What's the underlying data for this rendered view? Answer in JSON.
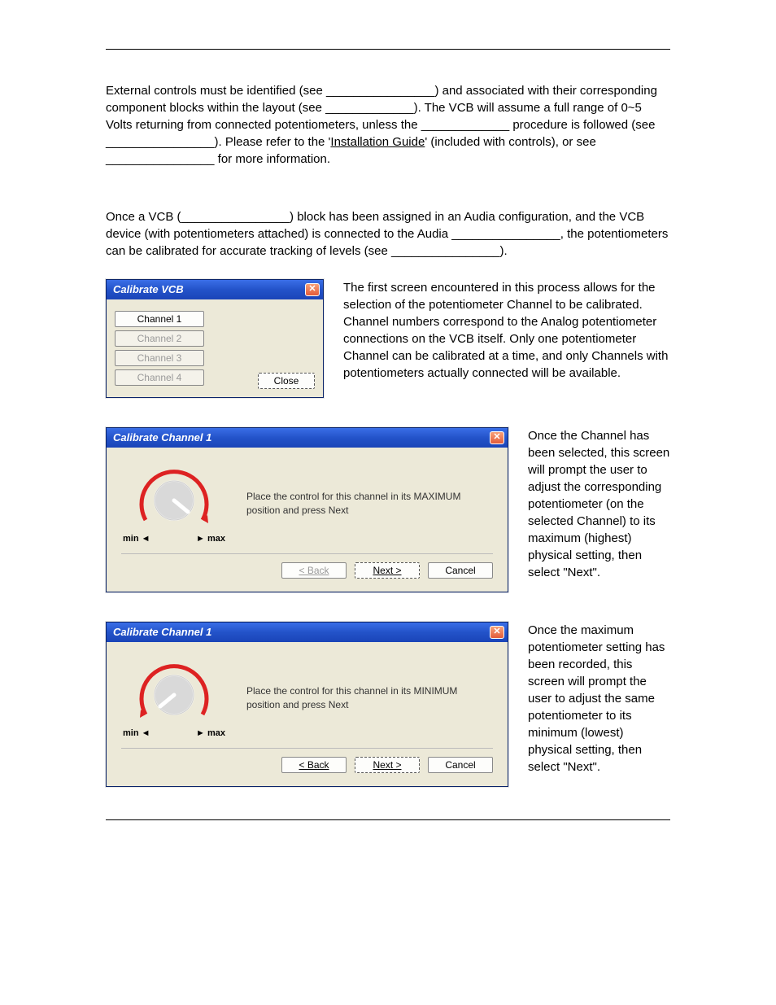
{
  "intro": {
    "p1_a": "External controls must be identified (see ",
    "p1_b": ") and associated with their corresponding component blocks within the layout (see ",
    "p1_c": "). The VCB will assume a full range of 0~5 Volts returning from connected potentiometers, unless the ",
    "p1_d": " procedure is followed (see ",
    "p1_e": "). Please refer to the '",
    "install_guide": "Installation Guide",
    "p1_f": "' (included with controls), or see ",
    "p1_g": " for more information."
  },
  "calibrate_intro": {
    "a": "Once a VCB (",
    "b": ") block has been assigned in an Audia configuration, and the VCB device (with potentiometers attached) is connected to the Audia ",
    "c": ", the potentiometers can be calibrated for accurate tracking of levels (see ",
    "d": ")."
  },
  "dlg1": {
    "title": "Calibrate VCB",
    "channels": [
      "Channel 1",
      "Channel 2",
      "Channel 3",
      "Channel 4"
    ],
    "close": "Close",
    "side_text": "The first screen encountered in this process allows for the selection of the potentiometer Channel to be calibrated. Channel numbers correspond to the Analog potentiometer connections on the VCB itself. Only one potentiometer Channel can be calibrated at a time, and only Channels with potentiometers actually connected will be available."
  },
  "dlg2": {
    "title": "Calibrate Channel 1",
    "instruction": "Place the control for this channel in its MAXIMUM position and press Next",
    "min": "min",
    "max": "max",
    "back": "< Back",
    "next": "Next >",
    "cancel": "Cancel",
    "side_text": "Once the Channel has been selected, this screen will prompt the user to adjust the corresponding potentiometer (on the selected Channel) to its maximum (highest) physical setting, then select \"Next\"."
  },
  "dlg3": {
    "title": "Calibrate Channel 1",
    "instruction": "Place the control for this channel in its MINIMUM position and press Next",
    "min": "min",
    "max": "max",
    "back": "< Back",
    "next": "Next >",
    "cancel": "Cancel",
    "side_text": "Once the maximum potentiometer setting has been recorded, this screen will prompt the user to adjust the same potentiometer to its minimum (lowest) physical setting, then select \"Next\"."
  },
  "blanks": {
    "long": "________________",
    "med": "_____________",
    "short": "___________"
  }
}
